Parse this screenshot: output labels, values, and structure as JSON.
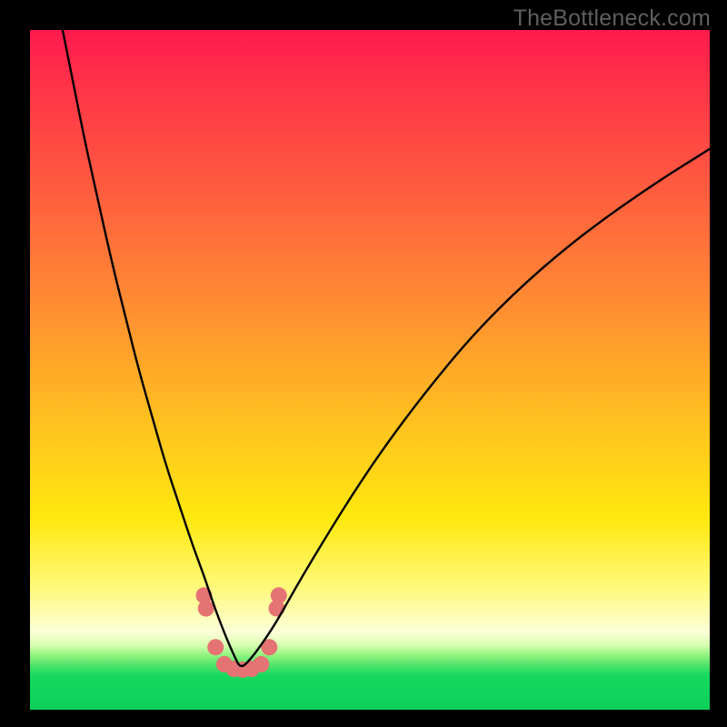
{
  "watermark": "TheBottleneck.com",
  "colors": {
    "frame": "#000000",
    "watermark": "#5f5f5f",
    "curve": "#000000",
    "marker": "#e57373",
    "gradient_top": "#ff1a4d",
    "gradient_bottom": "#0bd159"
  },
  "chart_data": {
    "type": "line",
    "title": "",
    "xlabel": "",
    "ylabel": "",
    "xlim": [
      0,
      100
    ],
    "ylim": [
      0,
      100
    ],
    "note": "x,y in percent of plot area; y measured from TOP (0=top, 100=bottom). Curve is a bottleneck V-shape with minimum near x≈31.",
    "series": [
      {
        "name": "bottleneck-curve",
        "x": [
          4.0,
          6.0,
          8.0,
          10.0,
          12.0,
          14.0,
          16.0,
          18.0,
          20.0,
          22.0,
          24.0,
          25.5,
          27.0,
          28.5,
          30.0,
          31.0,
          32.5,
          34.0,
          36.0,
          38.0,
          40.0,
          43.0,
          47.0,
          52.0,
          58.0,
          65.0,
          73.0,
          82.0,
          92.0,
          100.0
        ],
        "y": [
          -4.0,
          6.0,
          16.0,
          25.0,
          34.0,
          42.0,
          50.0,
          57.0,
          64.0,
          70.0,
          76.0,
          80.0,
          84.5,
          88.5,
          92.0,
          94.0,
          92.5,
          90.5,
          87.5,
          84.0,
          80.5,
          75.5,
          69.0,
          61.5,
          53.5,
          45.0,
          37.0,
          29.5,
          22.5,
          17.5
        ]
      }
    ],
    "markers": {
      "name": "highlight-dots",
      "x": [
        25.6,
        25.9,
        27.3,
        28.6,
        30.0,
        31.3,
        32.6,
        34.0,
        35.2,
        36.3,
        36.6
      ],
      "y": [
        83.2,
        85.1,
        90.8,
        93.3,
        94.0,
        94.1,
        94.0,
        93.3,
        90.8,
        85.1,
        83.2
      ],
      "r": [
        9,
        9,
        9,
        9,
        9,
        9,
        9,
        9,
        9,
        9,
        9
      ]
    }
  }
}
